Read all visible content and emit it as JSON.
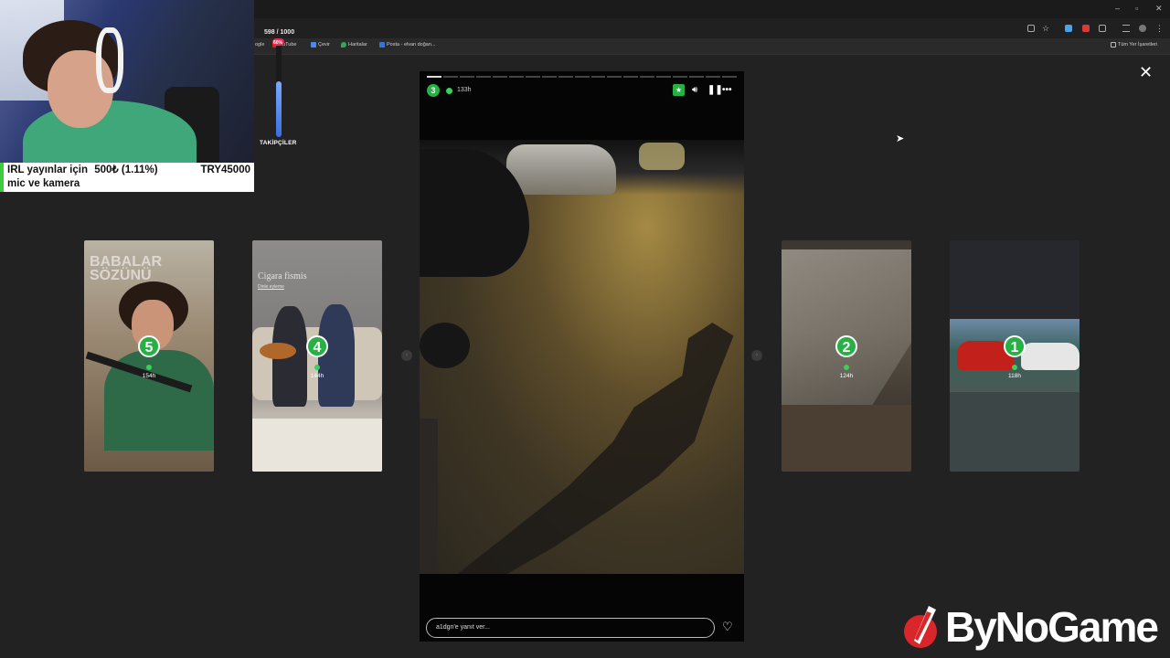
{
  "browser": {
    "tab_counter": "598 / 1000",
    "bookmarks": [
      {
        "label": "ogle",
        "icon": "google-icon"
      },
      {
        "label": "ouTube",
        "icon": "youtube-icon"
      },
      {
        "label": "Çevir",
        "icon": "translate-icon"
      },
      {
        "label": "Haritalar",
        "icon": "maps-icon"
      },
      {
        "label": "Posta - elvan doğan...",
        "icon": "mail-icon"
      }
    ],
    "all_bookmarks": "Tüm Yer İşaretleri"
  },
  "stream_overlay": {
    "donation_line1_left": "IRL yayınlar için",
    "donation_line1_mid": "500₺ (1.11%)",
    "donation_line1_right": "TRY45000",
    "donation_line2": "mic ve kamera",
    "followers_label": "TAKİPÇİLER",
    "followers_percent": "60%",
    "followers_progress": 0.6
  },
  "story_viewer": {
    "active_story": {
      "rank": "3",
      "time_ago": "133h",
      "reply_placeholder": "a1dgn'e yanıt ver..."
    },
    "progress_segments": 19,
    "progress_done": 1,
    "side_stories": [
      {
        "rank": "5",
        "time_ago": "154h",
        "overlay_text_line1": "BABALAR",
        "overlay_text_line2": "SÖZÜNÜ"
      },
      {
        "rank": "4",
        "time_ago": "144h",
        "overlay_title": "Cigara fismis",
        "overlay_sub": "Dinle eyleme"
      },
      {
        "rank": "2",
        "time_ago": "124h"
      },
      {
        "rank": "1",
        "time_ago": "118h"
      }
    ]
  },
  "watermark": {
    "brand": "ByNoGame"
  },
  "colors": {
    "accent_green": "#27b043",
    "online_dot": "#3ccf59",
    "logo_red": "#d8262a"
  }
}
